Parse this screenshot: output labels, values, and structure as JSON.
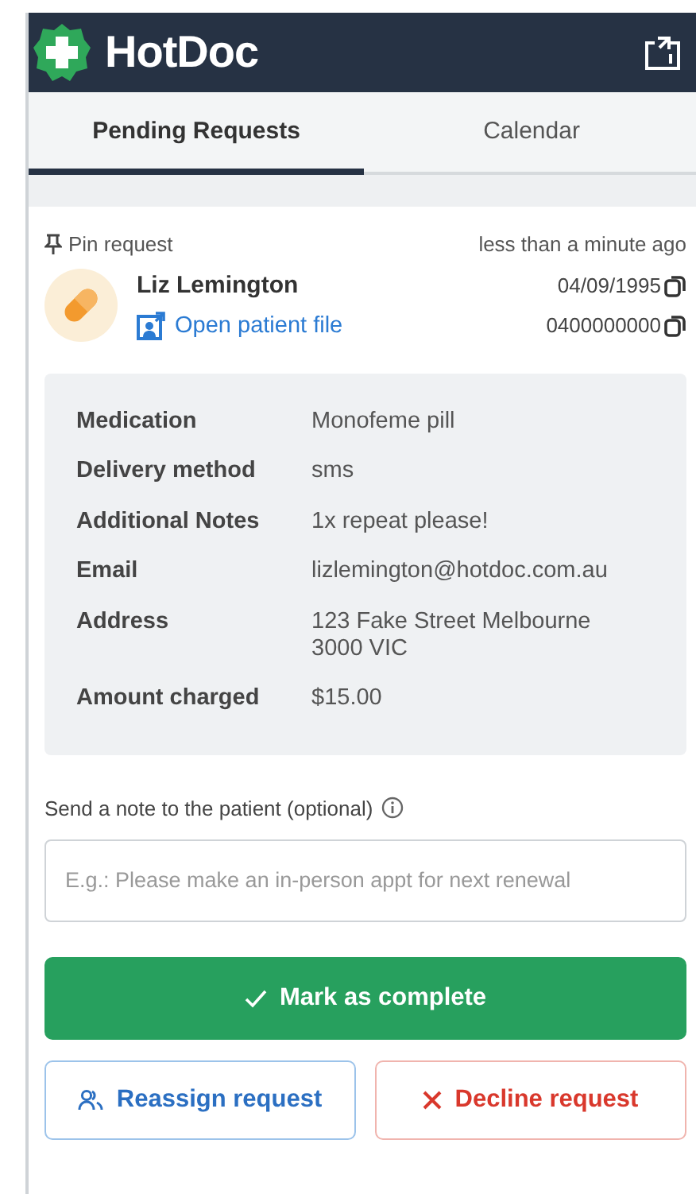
{
  "header": {
    "brand": "HotDoc"
  },
  "tabs": [
    {
      "label": "Pending Requests",
      "selected": true
    },
    {
      "label": "Calendar",
      "selected": false
    }
  ],
  "request": {
    "pin_label": "Pin request",
    "time": "less than a minute ago",
    "patient_name": "Liz Lemington",
    "open_file_link": "Open patient file",
    "dob": "04/09/1995",
    "phone": "0400000000"
  },
  "details": [
    {
      "label": "Medication",
      "value": "Monofeme pill"
    },
    {
      "label": "Delivery method",
      "value": "sms"
    },
    {
      "label": "Additional Notes",
      "value": "1x repeat please!"
    },
    {
      "label": "Email",
      "value": "lizlemington@hotdoc.com.au"
    },
    {
      "label": "Address",
      "value": "123 Fake Street Melbourne 3000 VIC"
    },
    {
      "label": "Amount charged",
      "value": "$15.00"
    }
  ],
  "note": {
    "label": "Send a note to the patient (optional)",
    "placeholder": "E.g.: Please make an in-person appt for next renewal"
  },
  "actions": [
    {
      "kind": "complete",
      "label": "Mark as complete"
    },
    {
      "kind": "reassign",
      "label": "Reassign request"
    },
    {
      "kind": "decline",
      "label": "Decline request"
    }
  ]
}
